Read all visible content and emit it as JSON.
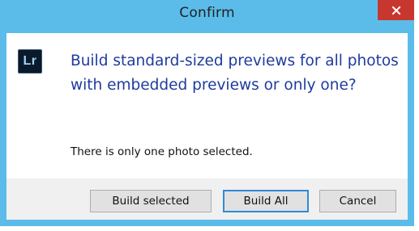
{
  "dialog": {
    "title": "Confirm",
    "icon_name": "lightroom-app-icon",
    "icon_text": "Lr",
    "main_instruction": "Build standard-sized previews for all photos with embedded previews or only one?",
    "content": "There is only one photo selected.",
    "buttons": {
      "build_selected": "Build selected",
      "build_all": "Build All",
      "cancel": "Cancel"
    },
    "default_button": "build_all"
  },
  "colors": {
    "titlebar": "#5bbcea",
    "close_button": "#c7372f",
    "instruction_text": "#1e3ba0",
    "footer": "#f0f0f0",
    "default_button_border": "#2e8bd8"
  }
}
